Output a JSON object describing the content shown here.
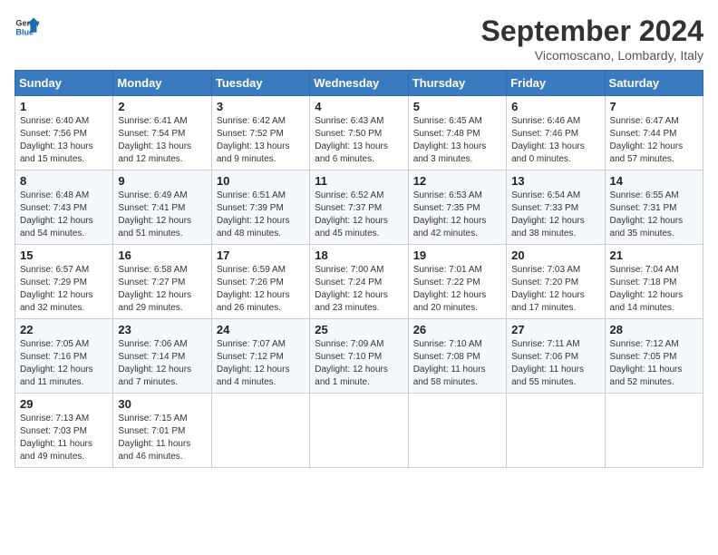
{
  "header": {
    "logo_line1": "General",
    "logo_line2": "Blue",
    "month": "September 2024",
    "location": "Vicomoscano, Lombardy, Italy"
  },
  "weekdays": [
    "Sunday",
    "Monday",
    "Tuesday",
    "Wednesday",
    "Thursday",
    "Friday",
    "Saturday"
  ],
  "weeks": [
    [
      {
        "day": "1",
        "text": "Sunrise: 6:40 AM\nSunset: 7:56 PM\nDaylight: 13 hours\nand 15 minutes."
      },
      {
        "day": "2",
        "text": "Sunrise: 6:41 AM\nSunset: 7:54 PM\nDaylight: 13 hours\nand 12 minutes."
      },
      {
        "day": "3",
        "text": "Sunrise: 6:42 AM\nSunset: 7:52 PM\nDaylight: 13 hours\nand 9 minutes."
      },
      {
        "day": "4",
        "text": "Sunrise: 6:43 AM\nSunset: 7:50 PM\nDaylight: 13 hours\nand 6 minutes."
      },
      {
        "day": "5",
        "text": "Sunrise: 6:45 AM\nSunset: 7:48 PM\nDaylight: 13 hours\nand 3 minutes."
      },
      {
        "day": "6",
        "text": "Sunrise: 6:46 AM\nSunset: 7:46 PM\nDaylight: 13 hours\nand 0 minutes."
      },
      {
        "day": "7",
        "text": "Sunrise: 6:47 AM\nSunset: 7:44 PM\nDaylight: 12 hours\nand 57 minutes."
      }
    ],
    [
      {
        "day": "8",
        "text": "Sunrise: 6:48 AM\nSunset: 7:43 PM\nDaylight: 12 hours\nand 54 minutes."
      },
      {
        "day": "9",
        "text": "Sunrise: 6:49 AM\nSunset: 7:41 PM\nDaylight: 12 hours\nand 51 minutes."
      },
      {
        "day": "10",
        "text": "Sunrise: 6:51 AM\nSunset: 7:39 PM\nDaylight: 12 hours\nand 48 minutes."
      },
      {
        "day": "11",
        "text": "Sunrise: 6:52 AM\nSunset: 7:37 PM\nDaylight: 12 hours\nand 45 minutes."
      },
      {
        "day": "12",
        "text": "Sunrise: 6:53 AM\nSunset: 7:35 PM\nDaylight: 12 hours\nand 42 minutes."
      },
      {
        "day": "13",
        "text": "Sunrise: 6:54 AM\nSunset: 7:33 PM\nDaylight: 12 hours\nand 38 minutes."
      },
      {
        "day": "14",
        "text": "Sunrise: 6:55 AM\nSunset: 7:31 PM\nDaylight: 12 hours\nand 35 minutes."
      }
    ],
    [
      {
        "day": "15",
        "text": "Sunrise: 6:57 AM\nSunset: 7:29 PM\nDaylight: 12 hours\nand 32 minutes."
      },
      {
        "day": "16",
        "text": "Sunrise: 6:58 AM\nSunset: 7:27 PM\nDaylight: 12 hours\nand 29 minutes."
      },
      {
        "day": "17",
        "text": "Sunrise: 6:59 AM\nSunset: 7:26 PM\nDaylight: 12 hours\nand 26 minutes."
      },
      {
        "day": "18",
        "text": "Sunrise: 7:00 AM\nSunset: 7:24 PM\nDaylight: 12 hours\nand 23 minutes."
      },
      {
        "day": "19",
        "text": "Sunrise: 7:01 AM\nSunset: 7:22 PM\nDaylight: 12 hours\nand 20 minutes."
      },
      {
        "day": "20",
        "text": "Sunrise: 7:03 AM\nSunset: 7:20 PM\nDaylight: 12 hours\nand 17 minutes."
      },
      {
        "day": "21",
        "text": "Sunrise: 7:04 AM\nSunset: 7:18 PM\nDaylight: 12 hours\nand 14 minutes."
      }
    ],
    [
      {
        "day": "22",
        "text": "Sunrise: 7:05 AM\nSunset: 7:16 PM\nDaylight: 12 hours\nand 11 minutes."
      },
      {
        "day": "23",
        "text": "Sunrise: 7:06 AM\nSunset: 7:14 PM\nDaylight: 12 hours\nand 7 minutes."
      },
      {
        "day": "24",
        "text": "Sunrise: 7:07 AM\nSunset: 7:12 PM\nDaylight: 12 hours\nand 4 minutes."
      },
      {
        "day": "25",
        "text": "Sunrise: 7:09 AM\nSunset: 7:10 PM\nDaylight: 12 hours\nand 1 minute."
      },
      {
        "day": "26",
        "text": "Sunrise: 7:10 AM\nSunset: 7:08 PM\nDaylight: 11 hours\nand 58 minutes."
      },
      {
        "day": "27",
        "text": "Sunrise: 7:11 AM\nSunset: 7:06 PM\nDaylight: 11 hours\nand 55 minutes."
      },
      {
        "day": "28",
        "text": "Sunrise: 7:12 AM\nSunset: 7:05 PM\nDaylight: 11 hours\nand 52 minutes."
      }
    ],
    [
      {
        "day": "29",
        "text": "Sunrise: 7:13 AM\nSunset: 7:03 PM\nDaylight: 11 hours\nand 49 minutes."
      },
      {
        "day": "30",
        "text": "Sunrise: 7:15 AM\nSunset: 7:01 PM\nDaylight: 11 hours\nand 46 minutes."
      },
      {
        "day": "",
        "text": ""
      },
      {
        "day": "",
        "text": ""
      },
      {
        "day": "",
        "text": ""
      },
      {
        "day": "",
        "text": ""
      },
      {
        "day": "",
        "text": ""
      }
    ]
  ]
}
